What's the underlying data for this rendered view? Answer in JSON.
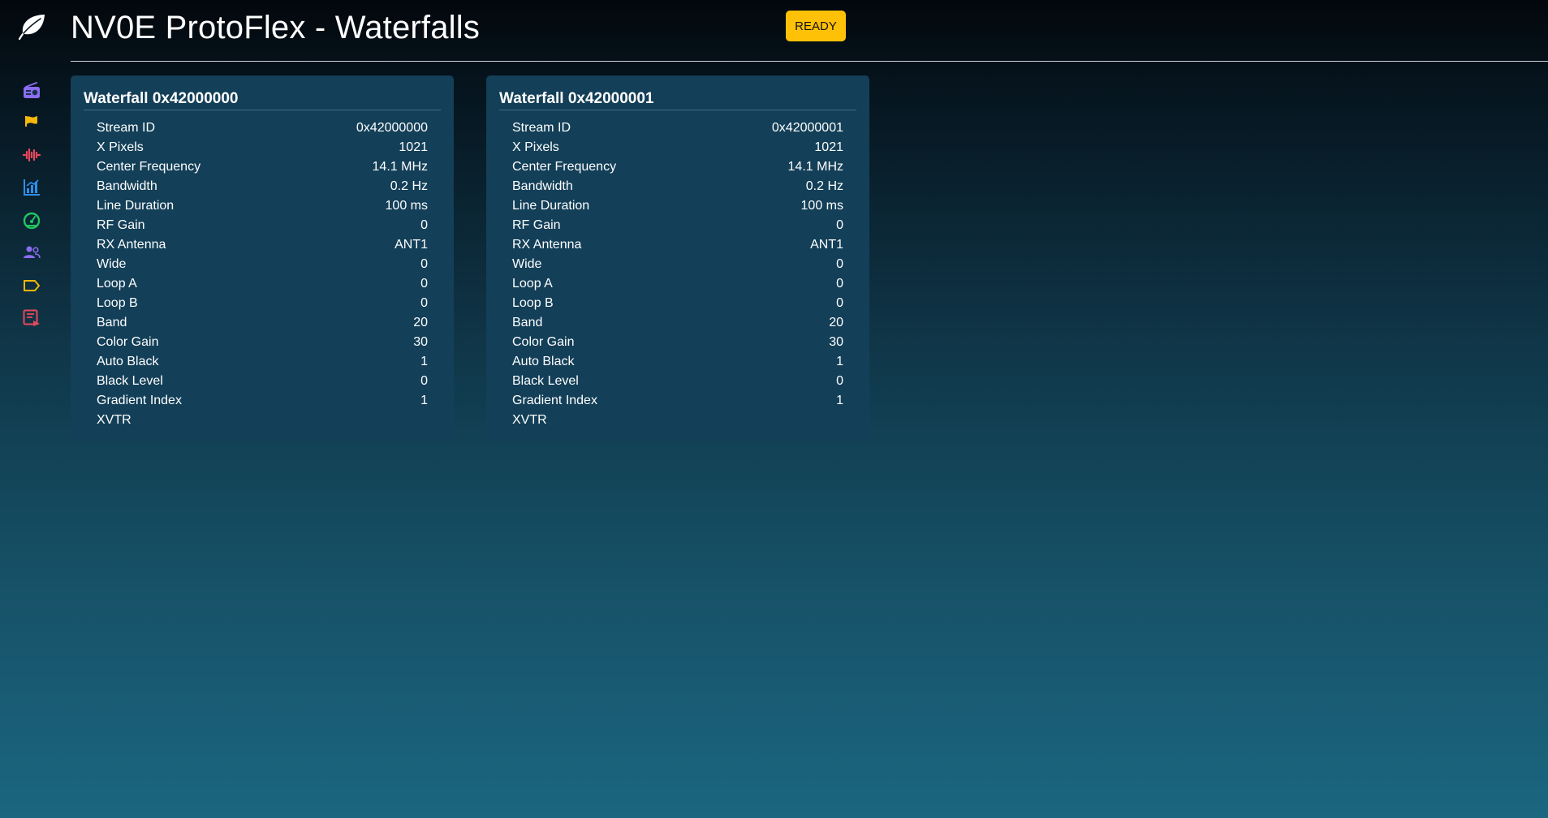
{
  "header": {
    "title": "NV0E ProtoFlex - Waterfalls",
    "status": "READY"
  },
  "sidebar": {
    "logo": "leaf-icon",
    "items": [
      {
        "icon": "radio-icon",
        "color": "#8b6cf2"
      },
      {
        "icon": "flag-icon",
        "color": "#f5b70a"
      },
      {
        "icon": "audio-wave-icon",
        "color": "#e8485c"
      },
      {
        "icon": "bar-chart-icon",
        "color": "#2f8fe8"
      },
      {
        "icon": "gauge-icon",
        "color": "#22c55e"
      },
      {
        "icon": "users-icon",
        "color": "#8b6cf2"
      },
      {
        "icon": "tag-icon",
        "color": "#f5b70a"
      },
      {
        "icon": "log-icon",
        "color": "#e8485c"
      }
    ]
  },
  "waterfalls": [
    {
      "title": "Waterfall 0x42000000",
      "rows": [
        {
          "label": "Stream ID",
          "value": "0x42000000"
        },
        {
          "label": "X Pixels",
          "value": "1021"
        },
        {
          "label": "Center Frequency",
          "value": "14.1 MHz"
        },
        {
          "label": "Bandwidth",
          "value": "0.2 Hz"
        },
        {
          "label": "Line Duration",
          "value": "100 ms"
        },
        {
          "label": "RF Gain",
          "value": "0"
        },
        {
          "label": "RX Antenna",
          "value": "ANT1"
        },
        {
          "label": "Wide",
          "value": "0"
        },
        {
          "label": "Loop A",
          "value": "0"
        },
        {
          "label": "Loop B",
          "value": "0"
        },
        {
          "label": "Band",
          "value": "20"
        },
        {
          "label": "Color Gain",
          "value": "30"
        },
        {
          "label": "Auto Black",
          "value": "1"
        },
        {
          "label": "Black Level",
          "value": "0"
        },
        {
          "label": "Gradient Index",
          "value": "1"
        },
        {
          "label": "XVTR",
          "value": ""
        }
      ]
    },
    {
      "title": "Waterfall 0x42000001",
      "rows": [
        {
          "label": "Stream ID",
          "value": "0x42000001"
        },
        {
          "label": "X Pixels",
          "value": "1021"
        },
        {
          "label": "Center Frequency",
          "value": "14.1 MHz"
        },
        {
          "label": "Bandwidth",
          "value": "0.2 Hz"
        },
        {
          "label": "Line Duration",
          "value": "100 ms"
        },
        {
          "label": "RF Gain",
          "value": "0"
        },
        {
          "label": "RX Antenna",
          "value": "ANT1"
        },
        {
          "label": "Wide",
          "value": "0"
        },
        {
          "label": "Loop A",
          "value": "0"
        },
        {
          "label": "Loop B",
          "value": "0"
        },
        {
          "label": "Band",
          "value": "20"
        },
        {
          "label": "Color Gain",
          "value": "30"
        },
        {
          "label": "Auto Black",
          "value": "1"
        },
        {
          "label": "Black Level",
          "value": "0"
        },
        {
          "label": "Gradient Index",
          "value": "1"
        },
        {
          "label": "XVTR",
          "value": ""
        }
      ]
    }
  ]
}
